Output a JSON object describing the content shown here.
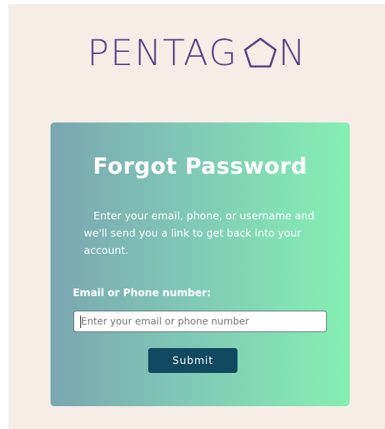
{
  "brand": {
    "logo_text_before": "PENTAG",
    "logo_text_after": "N",
    "logo_color": "#5b4287"
  },
  "card": {
    "title": "Forgot Password",
    "description": "Enter your email, phone, or username and we'll send you a link to get back into your account.",
    "gradient_start": "#7aa6b1",
    "gradient_end": "#85f0b2"
  },
  "form": {
    "field_label": "Email or Phone number:",
    "email_placeholder": "Enter your email or phone number",
    "email_value": "",
    "submit_label": "Submit",
    "submit_color": "#114961"
  },
  "page": {
    "background": "#f6ede6"
  }
}
